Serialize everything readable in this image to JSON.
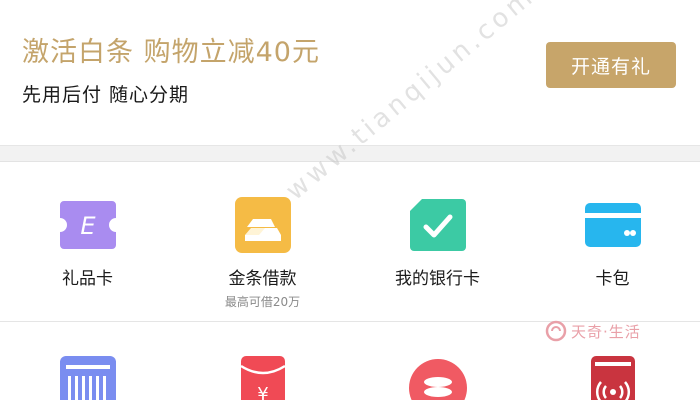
{
  "promo": {
    "title": "激活白条  购物立减40元",
    "subtitle": "先用后付 随心分期",
    "button_label": "开通有礼"
  },
  "grid": {
    "row1": [
      {
        "label": "礼品卡",
        "sublabel": "",
        "icon": "gift-card-icon",
        "color": "#a98cf0"
      },
      {
        "label": "金条借款",
        "sublabel": "最高可借20万",
        "icon": "gold-bars-icon",
        "color": "#f5bb45"
      },
      {
        "label": "我的银行卡",
        "sublabel": "",
        "icon": "bank-card-icon",
        "color": "#3ccaa4"
      },
      {
        "label": "卡包",
        "sublabel": "",
        "icon": "card-wallet-icon",
        "color": "#27b6ee"
      }
    ],
    "row2": [
      {
        "icon": "barcode-icon",
        "color": "#7a8df0"
      },
      {
        "icon": "red-envelope-icon",
        "color": "#f04a55"
      },
      {
        "icon": "coin-stack-icon",
        "color": "#f05a63"
      },
      {
        "icon": "nfc-card-icon",
        "color": "#c9343f"
      }
    ]
  },
  "watermark": {
    "diagonal": "www.tianqijun.com",
    "brand": "天奇·生活"
  }
}
